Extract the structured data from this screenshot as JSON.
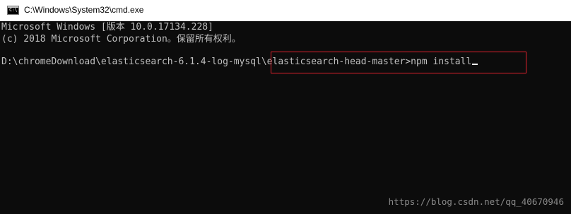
{
  "window": {
    "title": "C:\\Windows\\System32\\cmd.exe",
    "icon": "console-app-icon",
    "icon_text": "C:\\"
  },
  "console": {
    "lines": [
      "Microsoft Windows [版本 10.0.17134.228]",
      "(c) 2018 Microsoft Corporation。保留所有权利。",
      "D:\\chromeDownload\\elasticsearch-6.1.4-log-mysql\\elasticsearch-head-master>npm install"
    ],
    "background": "#0c0c0c",
    "foreground": "#c0c0c0",
    "highlight_color": "#e0212d"
  },
  "watermark": "https://blog.csdn.net/qq_40670946"
}
